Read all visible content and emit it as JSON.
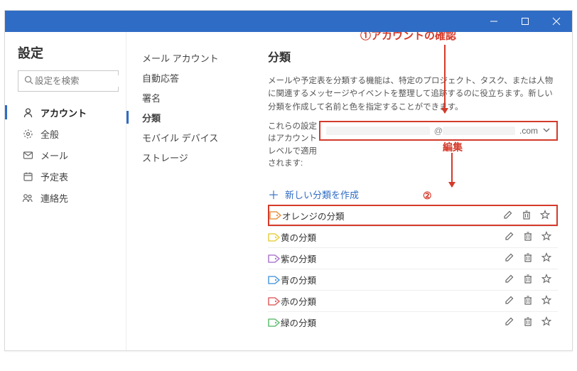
{
  "window": {
    "minimize": "minimize",
    "maximize": "maximize",
    "close": "close"
  },
  "pane1": {
    "title": "設定",
    "searchPlaceholder": "設定を検索",
    "items": [
      {
        "icon": "person",
        "label": "アカウント",
        "active": true
      },
      {
        "icon": "gear",
        "label": "全般"
      },
      {
        "icon": "mail",
        "label": "メール"
      },
      {
        "icon": "calendar",
        "label": "予定表"
      },
      {
        "icon": "people",
        "label": "連絡先"
      }
    ]
  },
  "pane2": {
    "items": [
      {
        "label": "メール アカウント"
      },
      {
        "label": "自動応答"
      },
      {
        "label": "署名"
      },
      {
        "label": "分類",
        "active": true
      },
      {
        "label": "モバイル デバイス"
      },
      {
        "label": "ストレージ"
      }
    ]
  },
  "pane3": {
    "title": "分類",
    "description": "メールや予定表を分類する機能は、特定のプロジェクト、タスク、または人物に関連するメッセージやイベントを整理して追跡するのに役立ちます。新しい分類を作成して名前と色を指定することができます。",
    "accountLabel": "これらの設定はアカウント レベルで適用されます:",
    "accountSuffix": ".com",
    "createLabel": "新しい分類を作成",
    "categories": [
      {
        "label": "オレンジの分類",
        "color": "#e89a4f"
      },
      {
        "label": "黄の分類",
        "color": "#e7d24a"
      },
      {
        "label": "紫の分類",
        "color": "#b07fd1"
      },
      {
        "label": "青の分類",
        "color": "#5aa0e0"
      },
      {
        "label": "赤の分類",
        "color": "#e06a6a"
      },
      {
        "label": "緑の分類",
        "color": "#6bbf7a"
      }
    ]
  },
  "annotations": {
    "a1": {
      "num": "①",
      "text": "アカウントの確認"
    },
    "a2": {
      "num": "②",
      "text": "編集"
    }
  }
}
